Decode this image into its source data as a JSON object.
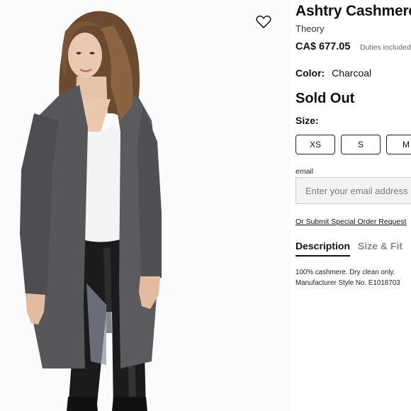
{
  "product": {
    "title": "Ashtry Cashmere",
    "brand": "Theory",
    "price": "CA$ 677.05",
    "duties_note": "Duties included",
    "color_label": "Color:",
    "color_value": "Charcoal",
    "availability": "Sold Out",
    "size_label": "Size:",
    "sizes": [
      "XS",
      "S",
      "M"
    ]
  },
  "notify": {
    "email_label": "email",
    "email_placeholder": "Enter your email address",
    "special_order_link": "Or Submit Special Order Request"
  },
  "tabs": [
    {
      "label": "Description",
      "active": true
    },
    {
      "label": "Size & Fit",
      "active": false
    }
  ],
  "description": {
    "line1": "100% cashmere. Dry clean only.",
    "line2": "Manufacturer Style No. E1018703"
  },
  "icons": {
    "wishlist": "heart-outline-icon"
  },
  "colors": {
    "cardigan": "#56565b",
    "text": "#111111",
    "muted": "#8a8a8a"
  }
}
